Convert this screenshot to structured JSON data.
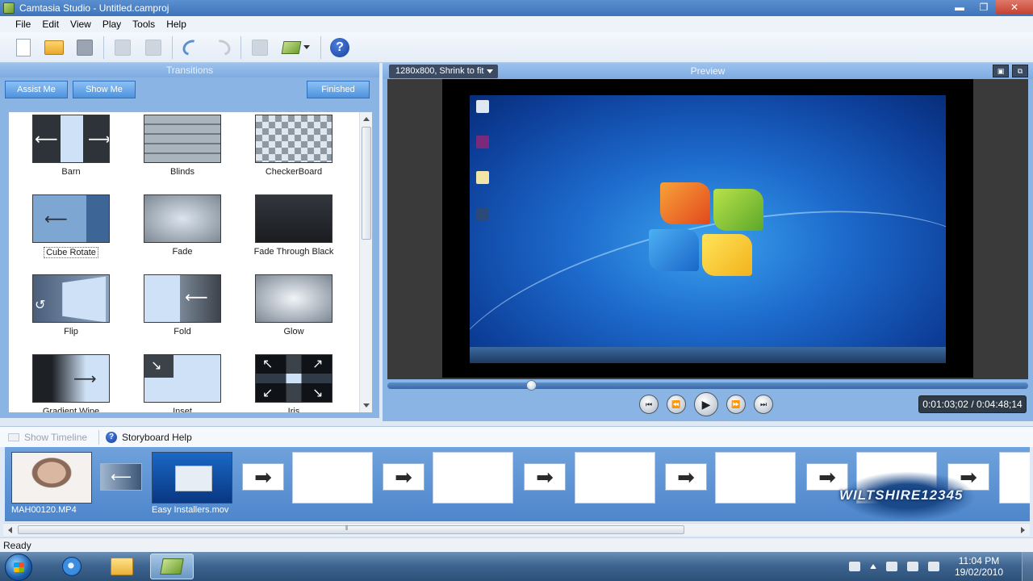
{
  "window": {
    "title": "Camtasia Studio - Untitled.camproj"
  },
  "menu": [
    "File",
    "Edit",
    "View",
    "Play",
    "Tools",
    "Help"
  ],
  "toolbar": {
    "help_label": "?"
  },
  "transitions": {
    "header": "Transitions",
    "assist_label": "Assist Me",
    "showme_label": "Show Me",
    "finished_label": "Finished",
    "items": [
      "Barn",
      "Blinds",
      "CheckerBoard",
      "Cube Rotate",
      "Fade",
      "Fade Through Black",
      "Flip",
      "Fold",
      "Glow",
      "Gradient Wipe",
      "Inset",
      "Iris"
    ]
  },
  "preview": {
    "size_label": "1280x800, Shrink to fit",
    "header": "Preview",
    "time_display": "0:01:03;02 / 0:04:48;14",
    "scrub_fraction": 0.22
  },
  "storyboard": {
    "show_timeline_label": "Show Timeline",
    "help_label": "Storyboard Help",
    "clips": [
      {
        "caption": "MAH00120.MP4"
      },
      {
        "caption": "Easy Installers.mov"
      }
    ],
    "arrow_glyph": "➡",
    "watermark": "WILTSHIRE12345"
  },
  "status": {
    "text": "Ready"
  },
  "taskbar": {
    "time": "11:04 PM",
    "date": "19/02/2010"
  },
  "colors": {
    "accent": "#4e93dd",
    "panel_bg": "#8ab4e4",
    "titlebar": "#3e74ba"
  }
}
